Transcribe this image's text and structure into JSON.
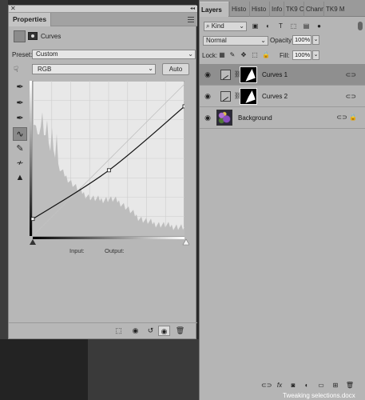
{
  "properties": {
    "tab_label": "Properties",
    "panel_title": "Curves",
    "preset_label": "Preset:",
    "preset_value": "Custom",
    "channel_value": "RGB",
    "auto_label": "Auto",
    "input_label": "Input:",
    "output_label": "Output:"
  },
  "curve": {
    "points": [
      [
        0,
        28
      ],
      [
        128,
        108
      ],
      [
        255,
        213
      ]
    ]
  },
  "layers": {
    "tabs": [
      "Layers",
      "Histo",
      "Histo",
      "Info",
      "TK9 C",
      "Chann",
      "TK9 M"
    ],
    "kind_label": "Kind",
    "blend_mode": "Normal",
    "opacity_label": "Opacity:",
    "opacity_value": "100%",
    "lock_label": "Lock:",
    "fill_label": "Fill:",
    "fill_value": "100%",
    "rows": [
      {
        "name": "Curves 1"
      },
      {
        "name": "Curves 2"
      },
      {
        "name": "Background"
      }
    ]
  },
  "caption": "Tweaking selections.docx",
  "colors": {
    "panel_bg": "#b7b7b7",
    "selected_row": "#8f8f8f",
    "dark_bg": "#2a2a2a"
  }
}
